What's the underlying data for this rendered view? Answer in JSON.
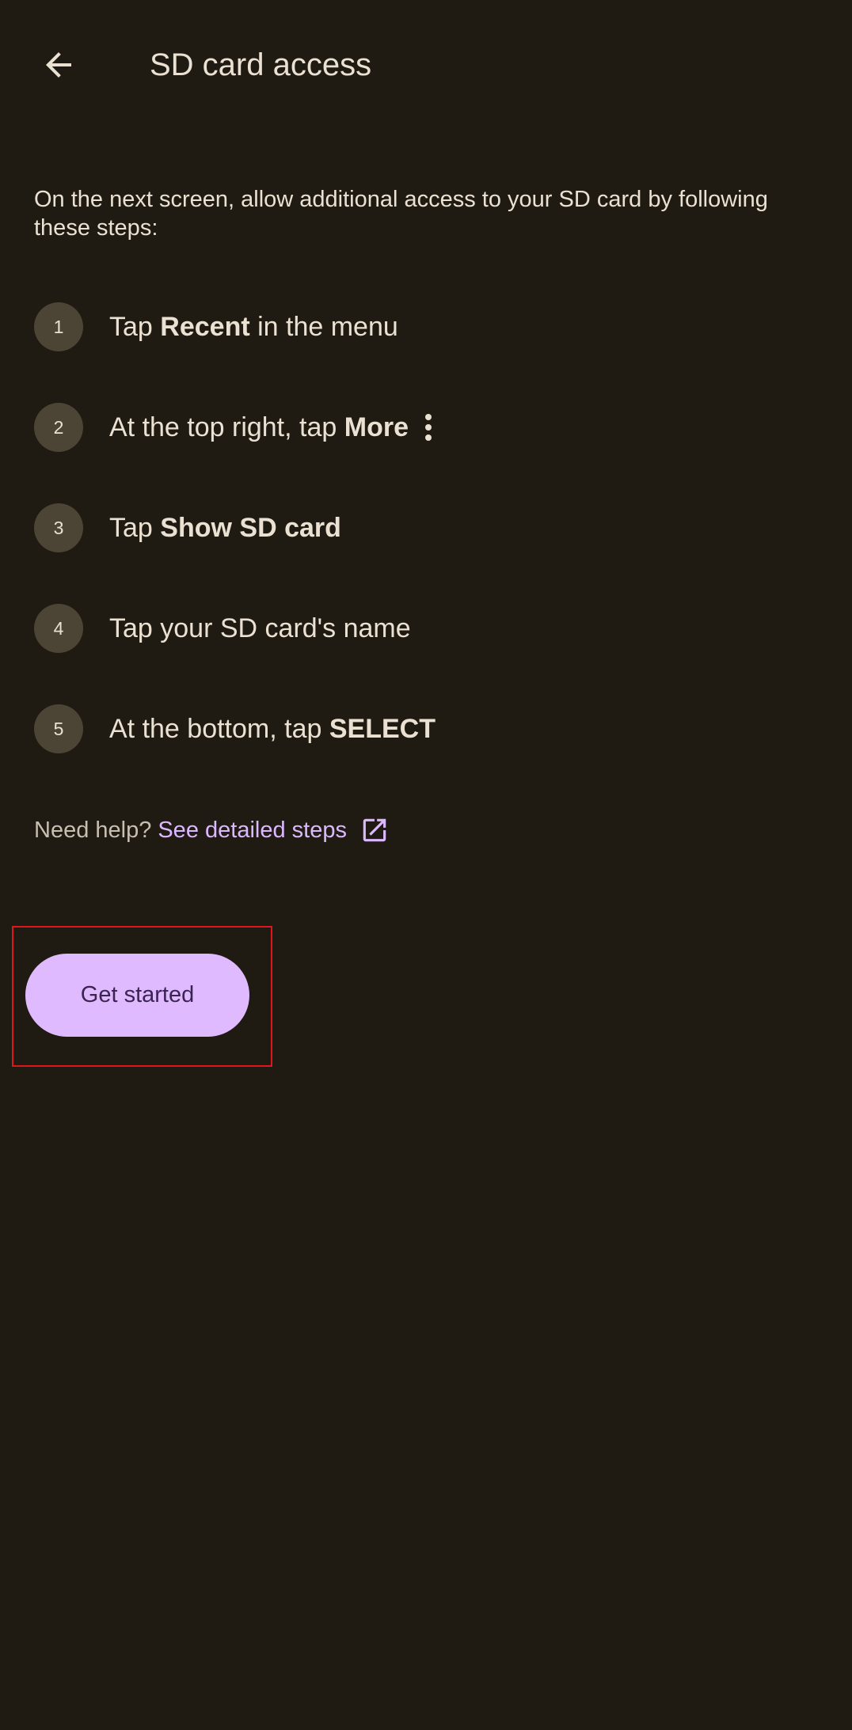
{
  "header": {
    "back_icon": "arrow-back-icon",
    "title": "SD card access"
  },
  "intro": "On the next screen, allow additional access to your SD card by following these steps:",
  "steps": [
    {
      "number": "1",
      "pre": "Tap",
      "bold": "Recent",
      "post": "in the menu"
    },
    {
      "number": "2",
      "pre": "At the top right, tap",
      "bold": "More",
      "post": "",
      "icon": "more-vert-icon"
    },
    {
      "number": "3",
      "pre": "Tap",
      "bold": "Show SD card",
      "post": ""
    },
    {
      "number": "4",
      "pre": "Tap your SD card's name",
      "bold": "",
      "post": ""
    },
    {
      "number": "5",
      "pre": "At the bottom, tap",
      "bold": "SELECT",
      "post": ""
    }
  ],
  "help": {
    "prefix": "Need help?",
    "link": "See detailed steps",
    "link_icon": "open-in-new-icon"
  },
  "primary_button": {
    "label": "Get started"
  },
  "colors": {
    "background": "#1f1b13",
    "text": "#ebe1d2",
    "badge": "#4c4536",
    "link": "#dcb8ff",
    "button": "#e0baff",
    "button_text": "#3b2451",
    "highlight": "#e0161d"
  }
}
